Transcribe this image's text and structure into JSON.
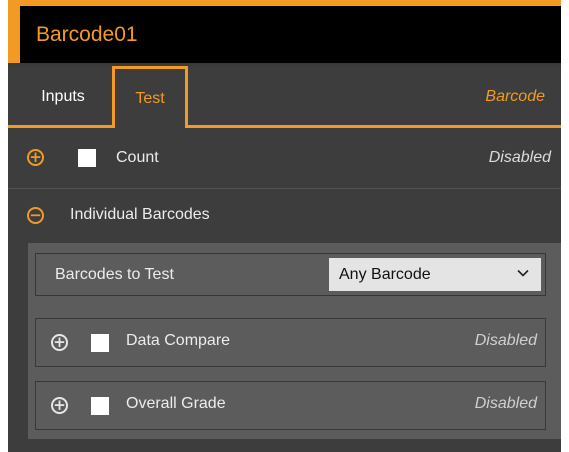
{
  "header": {
    "title": "Barcode01",
    "accent_color": "#f39a24"
  },
  "tabs": {
    "items": [
      {
        "label": "Inputs"
      },
      {
        "label": "Test"
      }
    ],
    "active": "Test",
    "context_label": "Barcode"
  },
  "count_row": {
    "expand_icon": "plus-circle-icon",
    "label": "Count",
    "status": "Disabled"
  },
  "individual_barcodes": {
    "collapse_icon": "minus-circle-icon",
    "label": "Individual Barcodes",
    "barcodes_to_test": {
      "label": "Barcodes to Test",
      "selected": "Any Barcode"
    },
    "sub_items": [
      {
        "label": "Data Compare",
        "status": "Disabled"
      },
      {
        "label": "Overall Grade",
        "status": "Disabled"
      }
    ]
  }
}
